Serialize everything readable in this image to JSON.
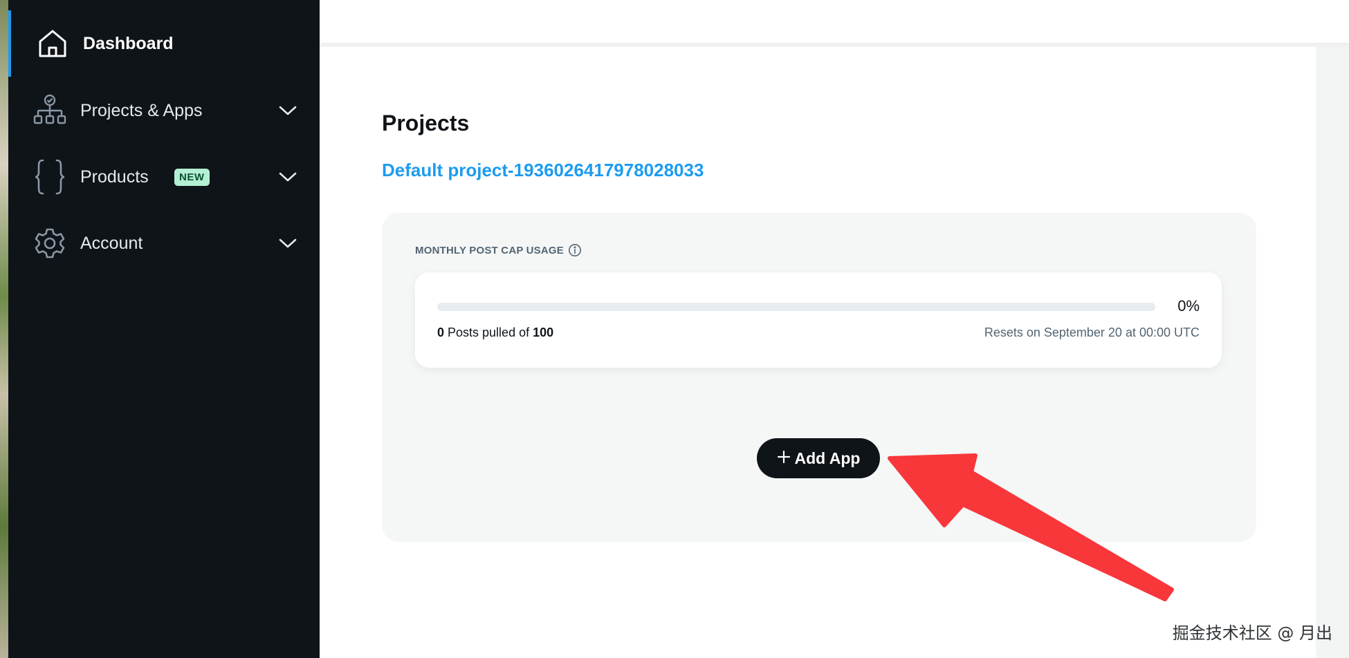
{
  "sidebar": {
    "items": [
      {
        "label": "Dashboard",
        "icon": "home-icon",
        "active": true
      },
      {
        "label": "Projects & Apps",
        "icon": "sitemap-icon",
        "expandable": true
      },
      {
        "label": "Products",
        "icon": "braces-icon",
        "badge": "NEW",
        "expandable": true
      },
      {
        "label": "Account",
        "icon": "gear-icon",
        "expandable": true
      }
    ]
  },
  "main": {
    "title": "Projects",
    "project_name": "Default project-1936026417978028033",
    "usage": {
      "label": "MONTHLY POST CAP USAGE",
      "percent_text": "0%",
      "percent_value": 0,
      "pulled": "0",
      "pulled_middle": " Posts pulled of ",
      "cap": "100",
      "reset_text": "Resets on September 20 at 00:00 UTC"
    },
    "add_app_label": "Add App"
  },
  "watermark": "掘金技术社区 @ 月出",
  "colors": {
    "sidebar_bg": "#0f1419",
    "accent": "#1d9bf0",
    "badge_bg": "#b3f0d3",
    "arrow": "#f8373b"
  }
}
